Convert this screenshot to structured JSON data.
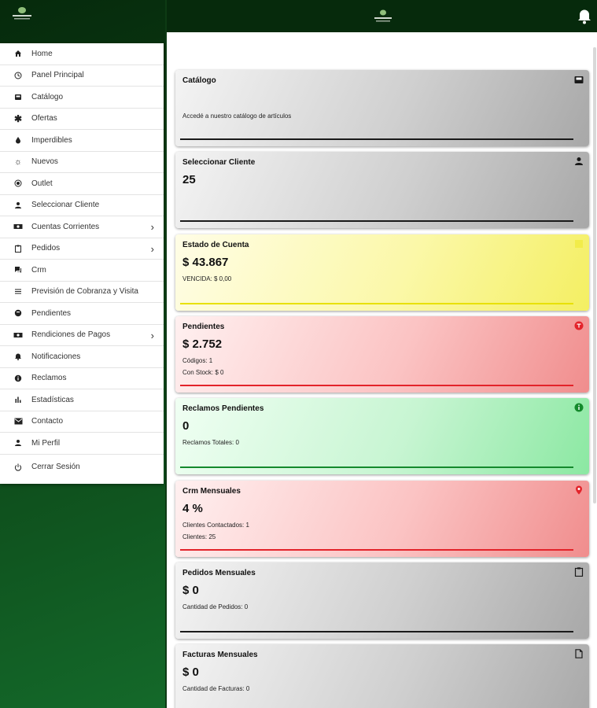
{
  "menu": {
    "items": [
      {
        "label": "Home",
        "icon": "home-icon"
      },
      {
        "label": "Panel Principal",
        "icon": "clock-icon"
      },
      {
        "label": "Catálogo",
        "icon": "inbox-icon"
      },
      {
        "label": "Ofertas",
        "icon": "asterisk-icon"
      },
      {
        "label": "Imperdibles",
        "icon": "drop-icon"
      },
      {
        "label": "Nuevos",
        "icon": "lightbulb-icon"
      },
      {
        "label": "Outlet",
        "icon": "target-icon"
      },
      {
        "label": "Seleccionar Cliente",
        "icon": "person-icon"
      },
      {
        "label": "Cuentas Corrientes",
        "icon": "money-icon",
        "chevron": true
      },
      {
        "label": "Pedidos",
        "icon": "clipboard-icon",
        "chevron": true
      },
      {
        "label": "Crm",
        "icon": "forum-icon"
      },
      {
        "label": "Previsión de Cobranza y Visita",
        "icon": "list-icon"
      },
      {
        "label": "Pendientes",
        "icon": "pending-icon"
      },
      {
        "label": "Rendiciones de Pagos",
        "icon": "money-icon",
        "chevron": true
      },
      {
        "label": "Notificaciones",
        "icon": "bell-icon"
      },
      {
        "label": "Reclamos",
        "icon": "info-icon"
      },
      {
        "label": "Estadísticas",
        "icon": "bar-chart-icon"
      },
      {
        "label": "Contacto",
        "icon": "mail-icon"
      },
      {
        "label": "Mi Perfil",
        "icon": "person-icon"
      },
      {
        "label": "Cerrar Sesión",
        "icon": "power-icon"
      }
    ]
  },
  "cards": [
    {
      "title": "Catálogo",
      "desc": "Accedé a nuestro catálogo de artículos",
      "icon": "inbox-icon",
      "color": "#1a1a1a"
    },
    {
      "title": "Seleccionar Cliente",
      "value": "25",
      "icon": "person-icon",
      "color": "#1a1a1a"
    },
    {
      "title": "Estado de Cuenta",
      "value": "$ 43.867",
      "line1": "VENCIDA: $ 0,00",
      "icon": "square-icon",
      "color": "#e8e100"
    },
    {
      "title": "Pendientes",
      "value": "$ 2.752",
      "line1": "Códigos: 1",
      "line2": "Con Stock: $ 0",
      "icon": "pending-icon",
      "color": "#e3232a"
    },
    {
      "title": "Reclamos Pendientes",
      "value": "0",
      "line1": "Reclamos Totales: 0",
      "icon": "info-icon",
      "color": "#14892c"
    },
    {
      "title": "Crm Mensuales",
      "value": "4 %",
      "line1": "Clientes Contactados: 1",
      "line2": "Clientes: 25",
      "icon": "location-pin-icon",
      "color": "#e3232a"
    },
    {
      "title": "Pedidos Mensuales",
      "value": "$ 0",
      "line1": "Cantidad de Pedidos: 0",
      "icon": "clipboard-icon",
      "color": "#1a1a1a"
    },
    {
      "title": "Facturas Mensuales",
      "value": "$ 0",
      "line1": "Cantidad de Facturas: 0",
      "icon": "file-icon",
      "color": "#1a1a1a"
    }
  ]
}
